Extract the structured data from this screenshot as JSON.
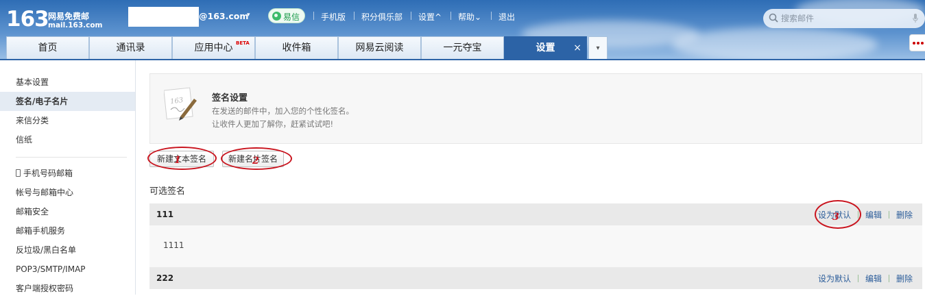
{
  "logo": {
    "number": "163",
    "name": "网易免费邮",
    "url": "mail.163.com"
  },
  "account": {
    "domain": "@163.com",
    "caret": "⌄"
  },
  "topbar": {
    "yixin_label": "易信",
    "links": [
      "手机版",
      "积分俱乐部",
      "设置^",
      "帮助⌄",
      "退出"
    ],
    "search_placeholder": "搜索邮件"
  },
  "tabs": [
    {
      "label": "首页"
    },
    {
      "label": "通讯录"
    },
    {
      "label": "应用中心",
      "badge": "BETA"
    },
    {
      "label": "收件箱"
    },
    {
      "label": "网易云阅读"
    },
    {
      "label": "一元夺宝"
    },
    {
      "label": "设置",
      "close": "×"
    }
  ],
  "tab_more": "⌄",
  "sidebar": {
    "items": [
      {
        "label": "基本设置"
      },
      {
        "label": "签名/电子名片"
      },
      {
        "label": "来信分类"
      },
      {
        "label": "信纸"
      },
      {
        "label": "手机号码邮箱"
      },
      {
        "label": "帐号与邮箱中心"
      },
      {
        "label": "邮箱安全"
      },
      {
        "label": "邮箱手机服务"
      },
      {
        "label": "反垃圾/黑白名单"
      },
      {
        "label": "POP3/SMTP/IMAP"
      },
      {
        "label": "客户端授权密码"
      }
    ],
    "active_index": 1
  },
  "intro": {
    "icon_text": "163",
    "title": "签名设置",
    "line1": "在发送的邮件中，加入您的个性化签名。",
    "line2": "让收件人更加了解你，赶紧试试吧!"
  },
  "buttons": {
    "new_text": "新建文本签名",
    "new_card": "新建名片签名"
  },
  "annotations": [
    "1",
    "2",
    "3"
  ],
  "section_title": "可选签名",
  "signatures": [
    {
      "name": "111",
      "content": "1111"
    },
    {
      "name": "222",
      "content": ""
    }
  ],
  "sig_actions": {
    "set_default": "设为默认",
    "edit": "编辑",
    "delete": "删除"
  },
  "colors": {
    "header_blue": "#2e6db5",
    "active_tab": "#2c63a6",
    "link": "#2c5d9a",
    "annotation_red": "#c9141e"
  }
}
